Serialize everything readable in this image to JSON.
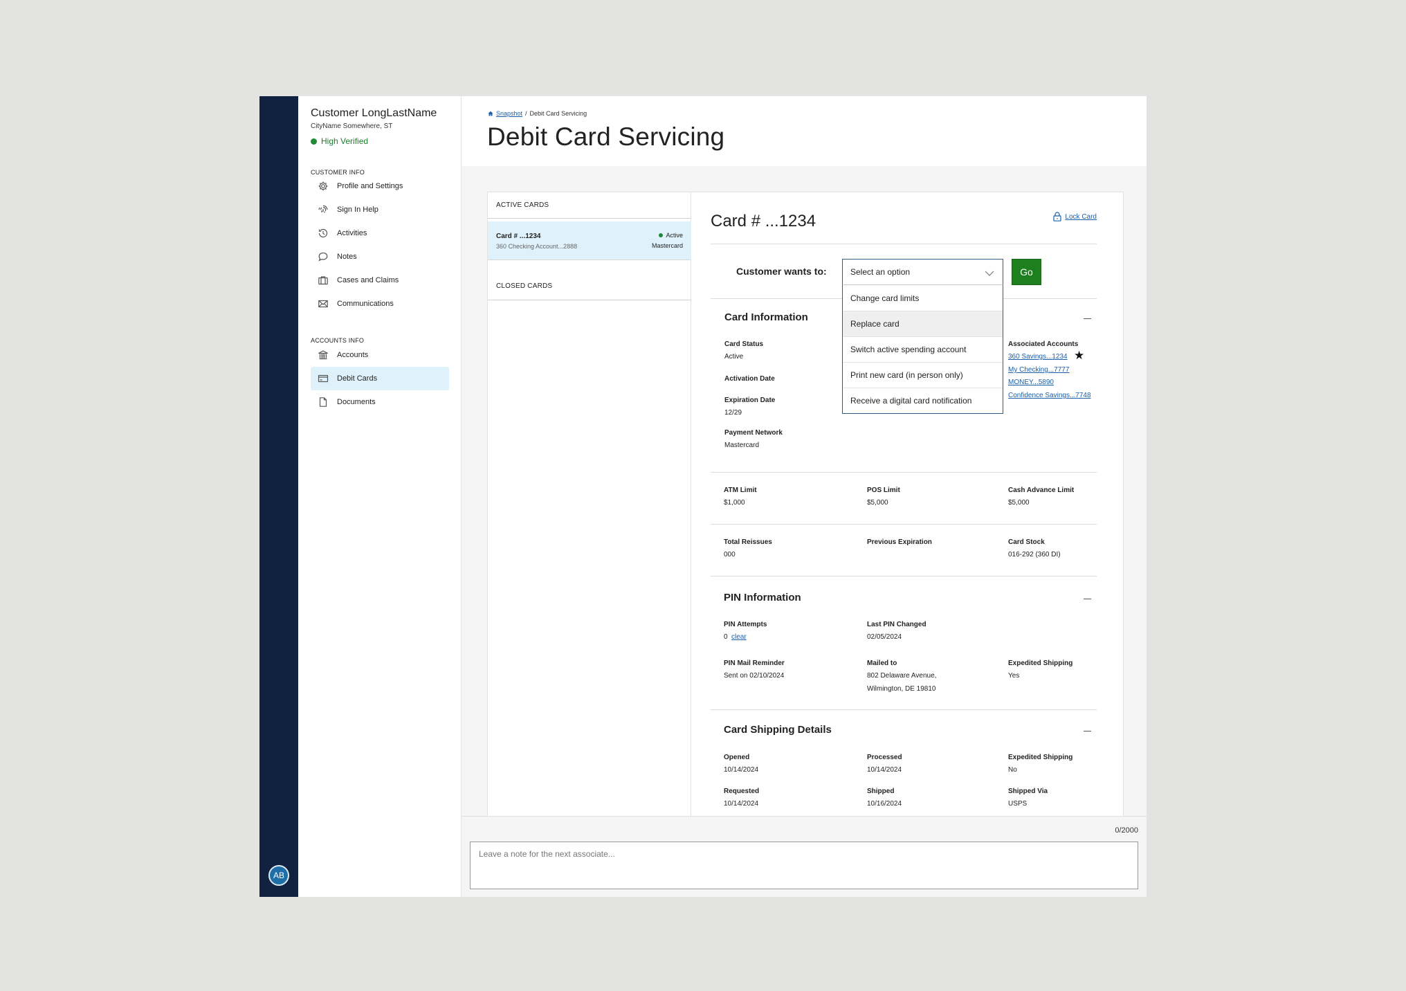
{
  "customer": {
    "name": "Customer LongLastName",
    "location": "CityName Somewhere, ST",
    "verification": "High Verified",
    "initials": "AB"
  },
  "sidebar": {
    "customer_info_label": "CUSTOMER INFO",
    "customer_items": [
      {
        "label": "Profile and Settings",
        "icon": "gear-icon"
      },
      {
        "label": "Sign In Help",
        "icon": "fingerprint-icon"
      },
      {
        "label": "Activities",
        "icon": "history-icon"
      },
      {
        "label": "Notes",
        "icon": "speech-bubble-icon"
      },
      {
        "label": "Cases and Claims",
        "icon": "briefcase-icon"
      },
      {
        "label": "Communications",
        "icon": "envelope-icon"
      }
    ],
    "accounts_info_label": "ACCOUNTS INFO",
    "account_items": [
      {
        "label": "Accounts",
        "icon": "bank-icon"
      },
      {
        "label": "Debit Cards",
        "icon": "credit-card-icon",
        "active": true
      },
      {
        "label": "Documents",
        "icon": "document-icon"
      }
    ]
  },
  "breadcrumb": {
    "home_link": "Snapshot",
    "separator": "/",
    "current": "Debit Card Servicing"
  },
  "page_title": "Debit Card Servicing",
  "card_list": {
    "active_label": "ACTIVE CARDS",
    "active_cards": [
      {
        "title": "Card # ...1234",
        "account": "360 Checking Account...2888",
        "status": "Active",
        "network": "Mastercard"
      }
    ],
    "closed_label": "CLOSED CARDS"
  },
  "detail": {
    "card_title": "Card # ...1234",
    "lock_label": "Lock Card",
    "wants_label": "Customer wants to:",
    "select_placeholder": "Select an option",
    "go_label": "Go",
    "options": [
      "Change card limits",
      "Replace card",
      "Switch active spending account",
      "Print new card (in person only)",
      "Receive a digital card notification"
    ],
    "card_info": {
      "title": "Card Information",
      "card_status_label": "Card Status",
      "card_status": "Active",
      "activation_date_label": "Activation Date",
      "expiration_date_label": "Expiration Date",
      "expiration_date": "12/29",
      "payment_network_label": "Payment Network",
      "payment_network": "Mastercard",
      "associated_label": "Associated Accounts",
      "associated_accounts": [
        "360 Savings...1234",
        "My Checking...7777",
        "MONEY...5890",
        "Confidence Savings...7748"
      ]
    },
    "limits": {
      "atm_label": "ATM Limit",
      "atm": "$1,000",
      "pos_label": "POS Limit",
      "pos": "$5,000",
      "cash_label": "Cash Advance Limit",
      "cash": "$5,000"
    },
    "reissue": {
      "total_label": "Total Reissues",
      "total": "000",
      "prev_exp_label": "Previous Expiration",
      "stock_label": "Card Stock",
      "stock": "016-292 (360 DI)"
    },
    "pin_info": {
      "title": "PIN Information",
      "attempts_label": "PIN Attempts",
      "attempts": "0",
      "clear_label": "clear",
      "last_changed_label": "Last PIN Changed",
      "last_changed": "02/05/2024",
      "reminder_label": "PIN Mail Reminder",
      "reminder": "Sent on 02/10/2024",
      "mailed_label": "Mailed to",
      "mailed_line1": "802 Delaware Avenue,",
      "mailed_line2": "Wilmington, DE 19810",
      "expedited_label": "Expedited Shipping",
      "expedited": "Yes"
    },
    "shipping": {
      "title": "Card Shipping Details",
      "opened_label": "Opened",
      "opened": "10/14/2024",
      "processed_label": "Processed",
      "processed": "10/14/2024",
      "expedited_label": "Expedited Shipping",
      "expedited": "No",
      "requested_label": "Requested",
      "requested": "10/14/2024",
      "shipped_label": "Shipped",
      "shipped": "10/16/2024",
      "via_label": "Shipped Via",
      "via": "USPS"
    }
  },
  "note": {
    "counter": "0/2000",
    "placeholder": "Leave a note for the next associate..."
  }
}
